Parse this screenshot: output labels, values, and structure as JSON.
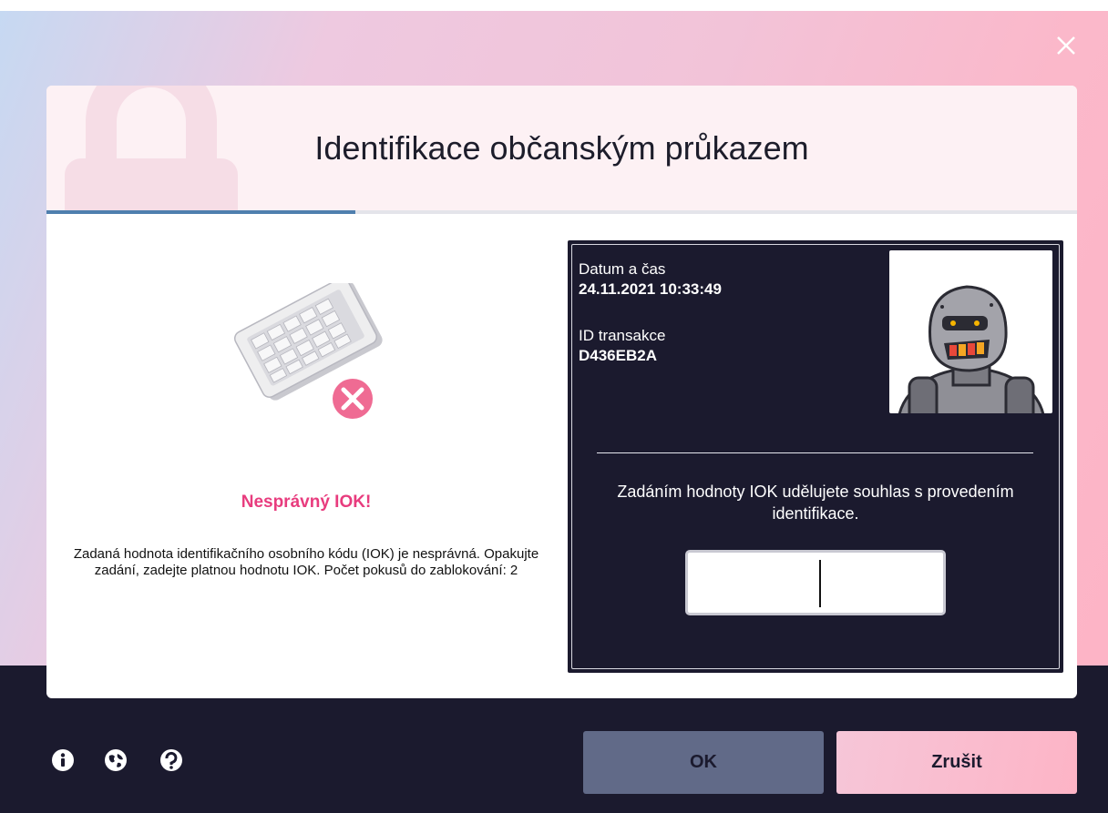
{
  "window": {
    "close_icon": "close-icon"
  },
  "dialog": {
    "title": "Identifikace občanským průkazem",
    "progress_fraction": 0.3
  },
  "error": {
    "illustration": "card-reader-error-icon",
    "title": "Nesprávný IOK!",
    "message": "Zadaná hodnota identifikačního osobního kódu (IOK) je nesprávná. Opakujte zadání, zadejte platnou hodnotu IOK. Počet pokusů do zablokování: 2"
  },
  "info": {
    "datetime_label": "Datum a čas",
    "datetime_value": "24.11.2021 10:33:49",
    "transaction_label": "ID transakce",
    "transaction_value": "D436EB2A",
    "avatar": "robot-avatar",
    "consent_text": "Zadáním hodnoty IOK udělujete souhlas s provedením identifikace.",
    "iok_value": ""
  },
  "footer": {
    "icons": [
      "info-icon",
      "globe-icon",
      "help-icon"
    ],
    "ok_label": "OK",
    "cancel_label": "Zrušit"
  },
  "colors": {
    "accent_pink": "#e83c7e",
    "dark": "#1b1a2e",
    "progress": "#4f7fae"
  }
}
